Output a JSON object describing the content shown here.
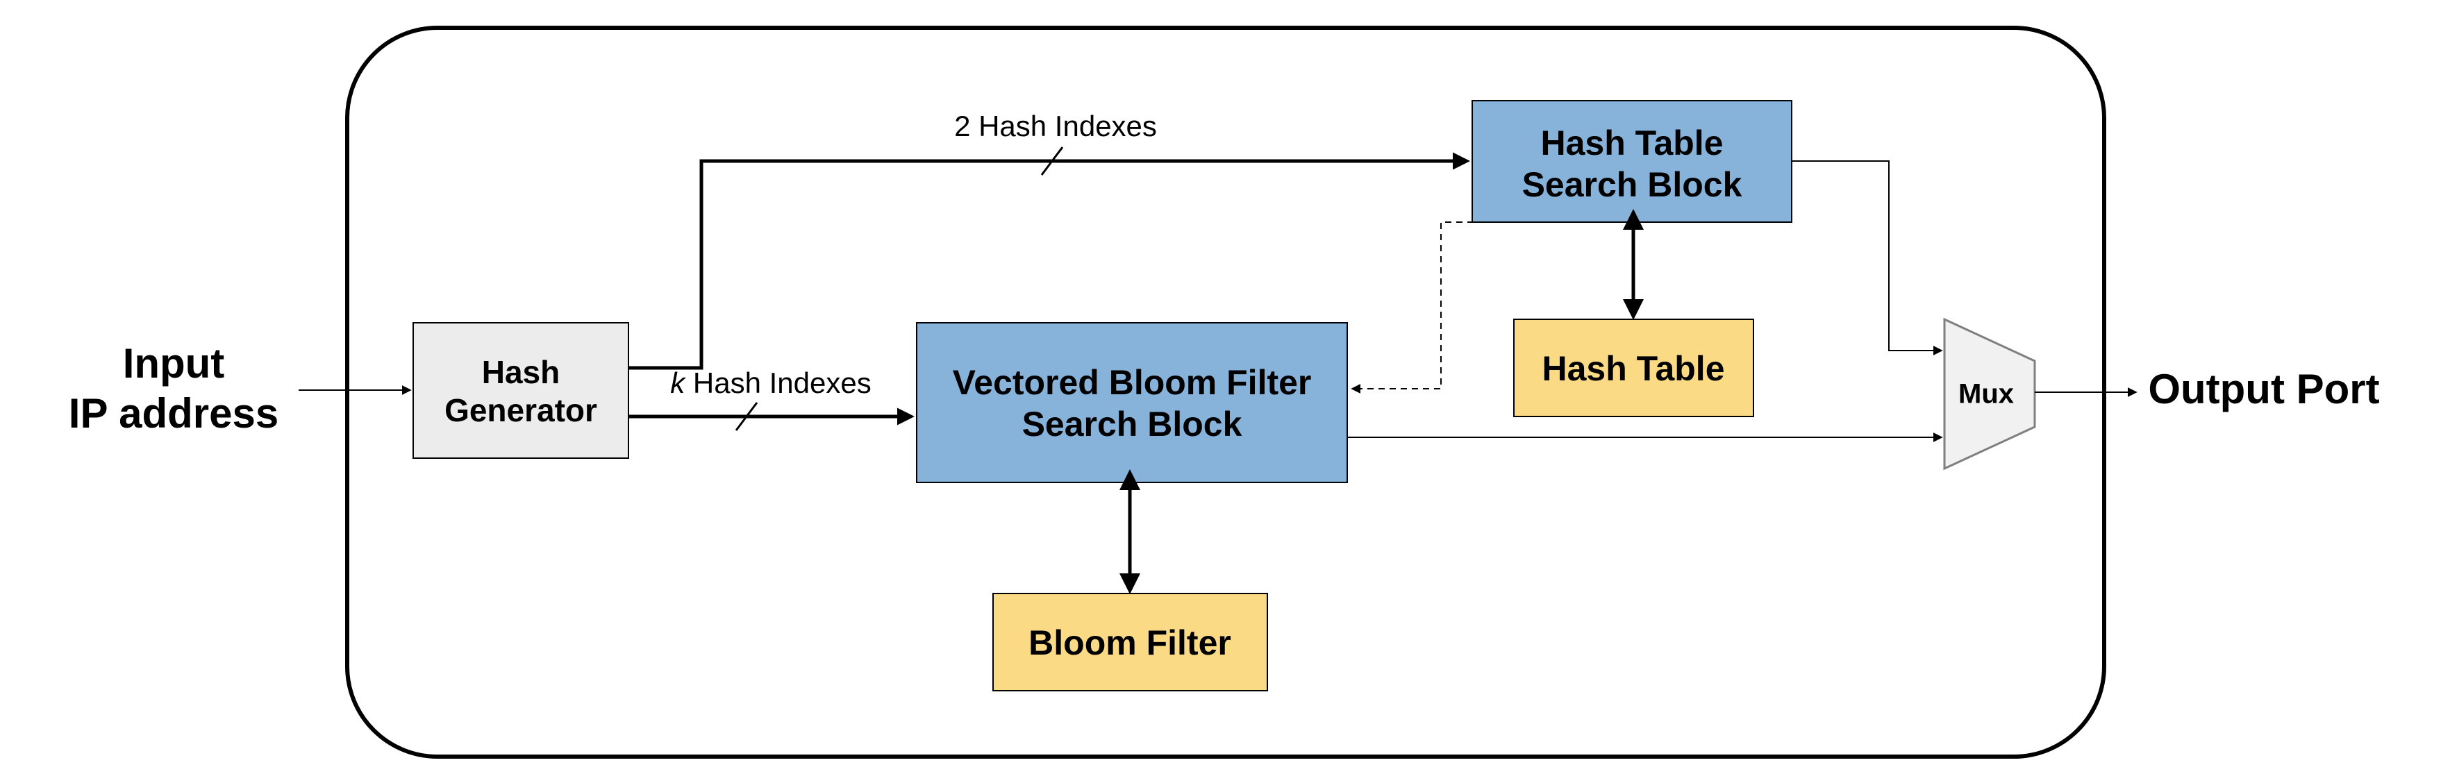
{
  "io": {
    "input_line1": "Input",
    "input_line2": "IP address",
    "output": "Output Port"
  },
  "blocks": {
    "hash_gen_line1": "Hash",
    "hash_gen_line2": "Generator",
    "vbf_line1": "Vectored Bloom Filter",
    "vbf_line2": "Search Block",
    "bloom_filter": "Bloom Filter",
    "htsb_line1": "Hash Table",
    "htsb_line2": "Search Block",
    "hash_table": "Hash Table",
    "mux": "Mux"
  },
  "edges": {
    "top_label": "2 Hash Indexes",
    "mid_label_k": "k",
    "mid_label_rest": " Hash Indexes"
  },
  "colors": {
    "blue_fill": "#87b3db",
    "blue_stroke": "#5b8bbd",
    "yellow_fill": "#fbda86",
    "yellow_stroke": "#d9b960",
    "gray_fill": "#ececec",
    "gray_stroke": "#9b9b9b",
    "mux_fill": "#f1f1f1",
    "mux_stroke": "#7f7f7f"
  }
}
